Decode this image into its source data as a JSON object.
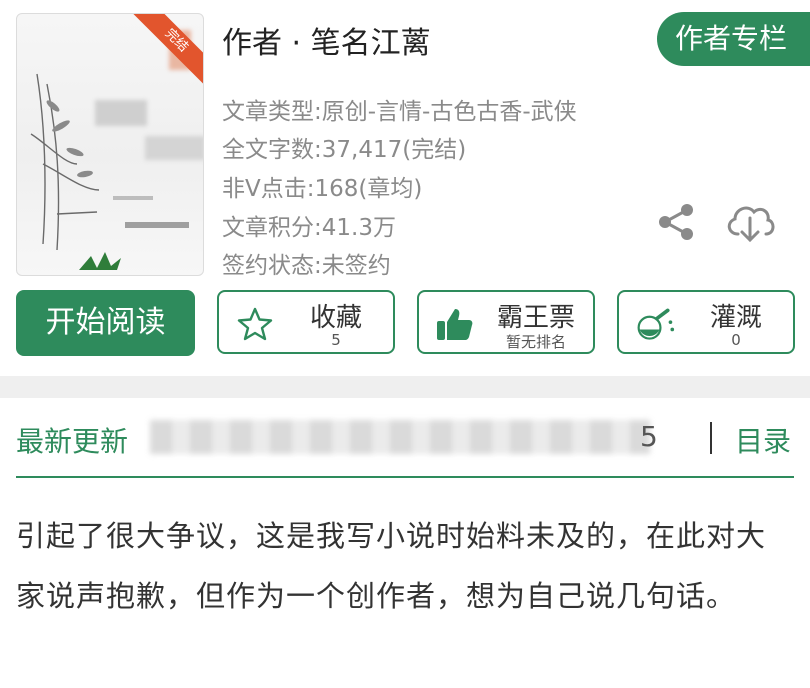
{
  "book": {
    "cover_ribbon": "完结",
    "author": "作者 · 笔名江蓠",
    "author_column_label": "作者专栏",
    "meta": [
      "文章类型:原创-言情-古色古香-武侠",
      "全文字数:37,417(完结)",
      "非V点击:168(章均)",
      "文章积分:41.3万",
      "签约状态:未签约"
    ]
  },
  "icons": {
    "share": "share-icon",
    "download": "cloud-download-icon"
  },
  "actions": {
    "read_label": "开始阅读",
    "favorite": {
      "label": "收藏",
      "sub": "5",
      "icon": "star-icon"
    },
    "ticket": {
      "label": "霸王票",
      "sub": "暂无排名",
      "icon": "thumbs-up-icon"
    },
    "water": {
      "label": "灌溉",
      "sub": "0",
      "icon": "flask-icon"
    }
  },
  "latest": {
    "label": "最新更新",
    "tail": "5",
    "toc_label": "目录"
  },
  "body_text": "引起了很大争议，这是我写小说时始料未及的，在此对大家说声抱歉，但作为一个创作者，想为自己说几句话。",
  "colors": {
    "accent": "#2e8b5c",
    "meta_text": "#8a8a8a",
    "ribbon": "#e2552d"
  }
}
